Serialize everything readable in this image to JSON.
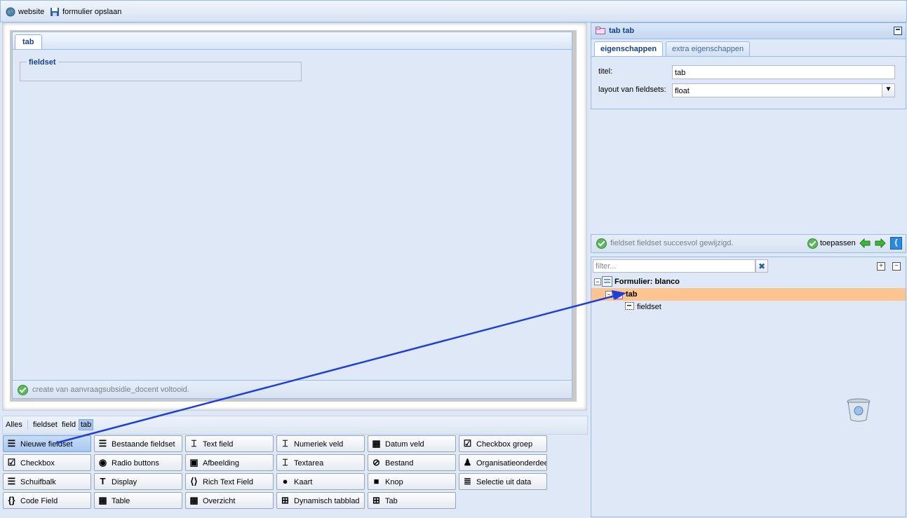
{
  "toolbar": {
    "website_label": "website",
    "save_label": "formulier opslaan"
  },
  "form_canvas": {
    "tab_label": "tab",
    "fieldset_legend": "fieldset",
    "status_text": "create van aanvraagsubsidie_docent voltooid."
  },
  "filter_bar": {
    "items": [
      "Alles",
      "fieldset",
      "field",
      "tab"
    ],
    "selected": "tab"
  },
  "palette": {
    "rows": [
      [
        {
          "label": "Nieuwe fieldset",
          "icon": "list-icon",
          "selected": true
        },
        {
          "label": "Bestaande fieldset",
          "icon": "list-icon"
        },
        {
          "label": "Text field",
          "icon": "textfield-icon"
        },
        {
          "label": "Numeriek veld",
          "icon": "number-field-icon"
        },
        {
          "label": "Datum veld",
          "icon": "calendar-icon"
        },
        {
          "label": "Checkbox groep",
          "icon": "checklist-icon"
        }
      ],
      [
        {
          "label": "Checkbox",
          "icon": "checkbox-icon"
        },
        {
          "label": "Radio buttons",
          "icon": "radio-icon"
        },
        {
          "label": "Afbeelding",
          "icon": "image-icon"
        },
        {
          "label": "Textarea",
          "icon": "textarea-icon"
        },
        {
          "label": "Bestand",
          "icon": "paperclip-icon"
        },
        {
          "label": "Organisatieonderdeel",
          "icon": "org-icon"
        }
      ],
      [
        {
          "label": "Schuifbalk",
          "icon": "slider-icon"
        },
        {
          "label": "Display",
          "icon": "display-text-icon"
        },
        {
          "label": "Rich Text Field",
          "icon": "code-tag-icon"
        },
        {
          "label": "Kaart",
          "icon": "globe-icon"
        },
        {
          "label": "Knop",
          "icon": "button-icon"
        },
        {
          "label": "Selectie uit data",
          "icon": "database-icon"
        }
      ],
      [
        {
          "label": "Code Field",
          "icon": "braces-icon"
        },
        {
          "label": "Table",
          "icon": "table-icon"
        },
        {
          "label": "Overzicht",
          "icon": "grid-icon"
        },
        {
          "label": "Dynamisch tabblad",
          "icon": "dynamic-tab-icon"
        },
        {
          "label": "Tab",
          "icon": "tab-add-icon"
        }
      ]
    ]
  },
  "properties": {
    "header_title": "tab tab",
    "tabs": [
      "eigenschappen",
      "extra eigenschappen"
    ],
    "title_label": "titel:",
    "title_value": "tab",
    "layout_label": "layout van fieldsets:",
    "layout_value": "float"
  },
  "action_bar": {
    "status_text": "fieldset fieldset succesvol gewijzigd.",
    "apply_label": "toepassen"
  },
  "tree": {
    "filter_placeholder": "filter...",
    "root_label": "Formulier: blanco",
    "tab_label": "tab",
    "fieldset_label": "fieldset"
  },
  "colors": {
    "accent": "#15428b",
    "panel_bg": "#dfe8f6",
    "selected_row": "#fcc48f",
    "arrow": "#1f3fdd"
  }
}
